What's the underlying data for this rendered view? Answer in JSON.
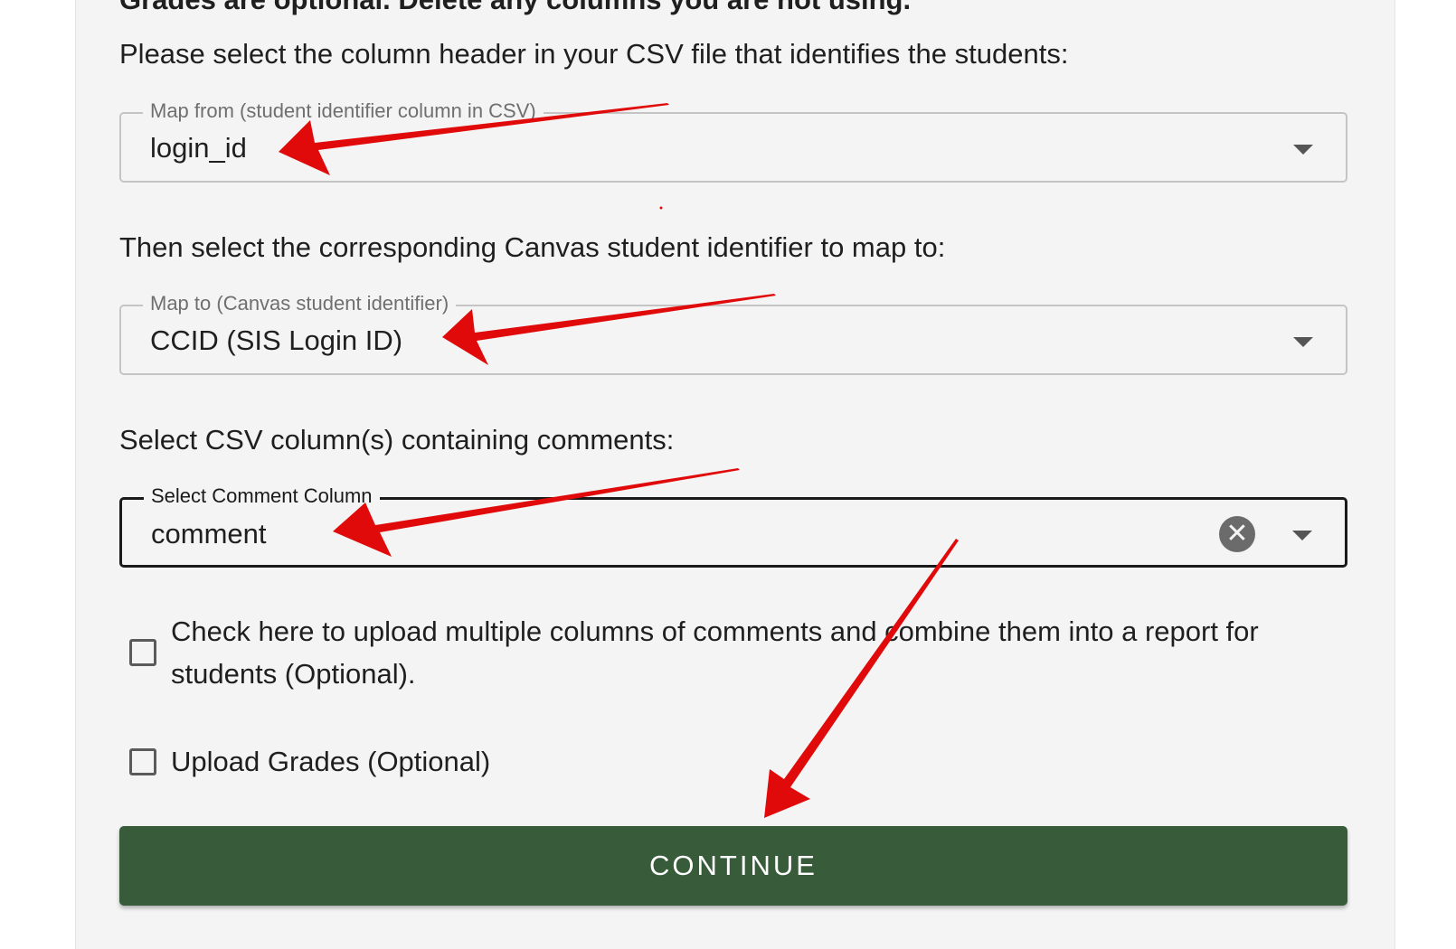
{
  "header": {
    "cutoff_text": "Grades are optional. Delete any columns you are not using."
  },
  "map_from": {
    "prompt": "Please select the column header in your CSV file that identifies the students:",
    "label": "Map from (student identifier column in CSV)",
    "value": "login_id"
  },
  "map_to": {
    "prompt": "Then select the corresponding Canvas student identifier to map to:",
    "label": "Map to (Canvas student identifier)",
    "value": "CCID (SIS Login ID)"
  },
  "comments": {
    "prompt": "Select CSV column(s) containing comments:",
    "label": "Select Comment Column",
    "value": "comment",
    "clear_glyph": "✕"
  },
  "options": {
    "multiple_comments_label": "Check here to upload multiple columns of comments and combine them into a report for students (Optional).",
    "multiple_comments_checked": false,
    "upload_grades_label": "Upload Grades (Optional)",
    "upload_grades_checked": false
  },
  "actions": {
    "continue_label": "CONTINUE"
  },
  "colors": {
    "primary_button": "#385b3a",
    "annotation_arrow": "#e10a0a",
    "panel_background": "#f4f4f4"
  },
  "icons": {
    "dropdown": "chevron-down-icon",
    "clear": "clear-icon"
  }
}
